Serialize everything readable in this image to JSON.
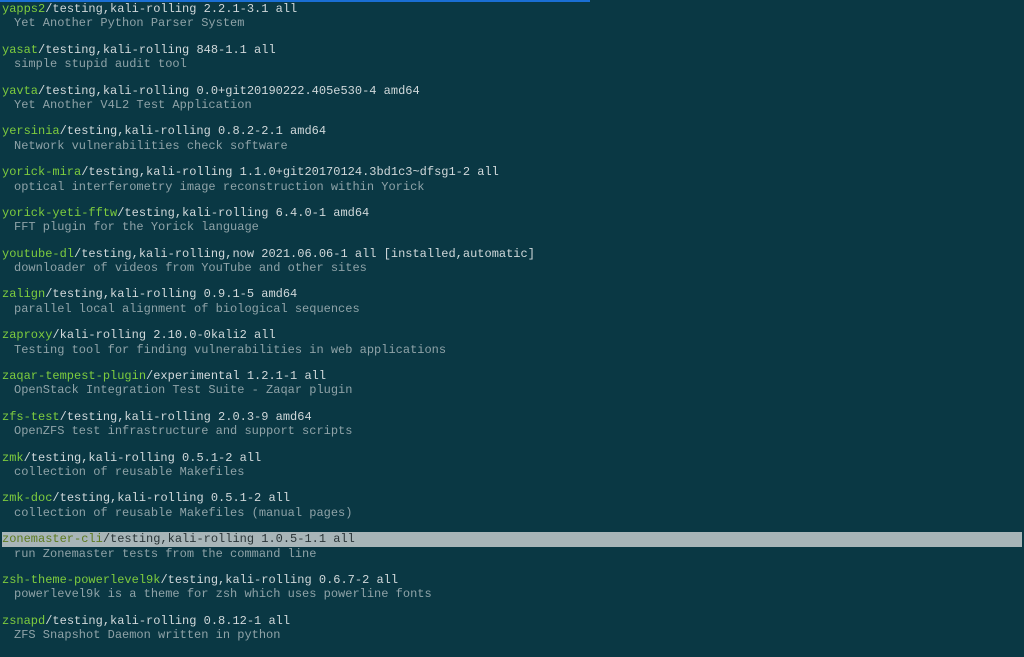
{
  "packages": [
    {
      "name": "yapps2",
      "version": "/testing,kali-rolling 2.2.1-3.1 all",
      "description": "Yet Another Python Parser System",
      "highlighted": false
    },
    {
      "name": "yasat",
      "version": "/testing,kali-rolling 848-1.1 all",
      "description": "simple stupid audit tool",
      "highlighted": false
    },
    {
      "name": "yavta",
      "version": "/testing,kali-rolling 0.0+git20190222.405e530-4 amd64",
      "description": "Yet Another V4L2 Test Application",
      "highlighted": false
    },
    {
      "name": "yersinia",
      "version": "/testing,kali-rolling 0.8.2-2.1 amd64",
      "description": "Network vulnerabilities check software",
      "highlighted": false
    },
    {
      "name": "yorick-mira",
      "version": "/testing,kali-rolling 1.1.0+git20170124.3bd1c3~dfsg1-2 all",
      "description": "optical interferometry image reconstruction within Yorick",
      "highlighted": false
    },
    {
      "name": "yorick-yeti-fftw",
      "version": "/testing,kali-rolling 6.4.0-1 amd64",
      "description": "FFT plugin for the Yorick language",
      "highlighted": false
    },
    {
      "name": "youtube-dl",
      "version": "/testing,kali-rolling,now 2021.06.06-1 all ",
      "installed": "[installed,automatic]",
      "description": "downloader of videos from YouTube and other sites",
      "highlighted": false
    },
    {
      "name": "zalign",
      "version": "/testing,kali-rolling 0.9.1-5 amd64",
      "description": "parallel local alignment of biological sequences",
      "highlighted": false
    },
    {
      "name": "zaproxy",
      "version": "/kali-rolling 2.10.0-0kali2 all",
      "description": "Testing tool for finding vulnerabilities in web applications",
      "highlighted": false
    },
    {
      "name": "zaqar-tempest-plugin",
      "version": "/experimental 1.2.1-1 all",
      "description": "OpenStack Integration Test Suite - Zaqar plugin",
      "highlighted": false
    },
    {
      "name": "zfs-test",
      "version": "/testing,kali-rolling 2.0.3-9 amd64",
      "description": "OpenZFS test infrastructure and support scripts",
      "highlighted": false
    },
    {
      "name": "zmk",
      "version": "/testing,kali-rolling 0.5.1-2 all",
      "description": "collection of reusable Makefiles",
      "highlighted": false
    },
    {
      "name": "zmk-doc",
      "version": "/testing,kali-rolling 0.5.1-2 all",
      "description": "collection of reusable Makefiles (manual pages)",
      "highlighted": false
    },
    {
      "name": "zonemaster-cli",
      "version": "/testing,kali-rolling 1.0.5-1.1 all",
      "description": "run Zonemaster tests from the command line",
      "highlighted": true
    },
    {
      "name": "zsh-theme-powerlevel9k",
      "version": "/testing,kali-rolling 0.6.7-2 all",
      "description": "powerlevel9k is a theme for zsh which uses powerline fonts",
      "highlighted": false
    },
    {
      "name": "zsnapd",
      "version": "/testing,kali-rolling 0.8.12-1 all",
      "description": "ZFS Snapshot Daemon written in python",
      "highlighted": false
    }
  ]
}
